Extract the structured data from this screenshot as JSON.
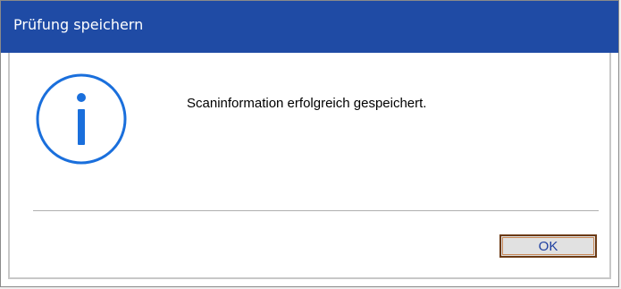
{
  "window": {
    "title": "Prüfung speichern"
  },
  "dialog": {
    "icon": "info-icon",
    "message": "Scaninformation erfolgreich gespeichert.",
    "ok_label": "OK"
  },
  "colors": {
    "titlebar": "#1f4ba5",
    "icon": "#1a6fdc",
    "ok_border": "#6b3a14"
  }
}
